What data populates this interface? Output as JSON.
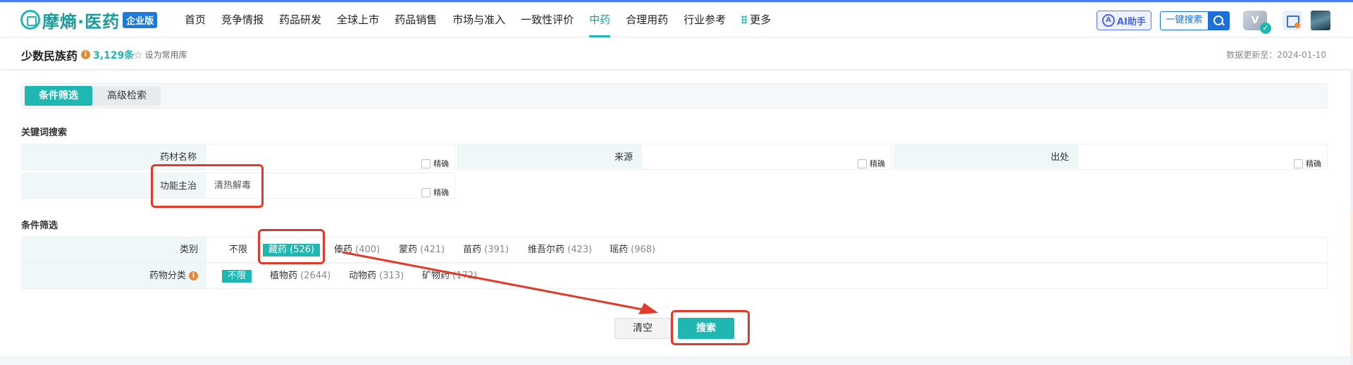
{
  "app": {
    "logo_text": "摩熵·医药",
    "edition_badge": "企业版"
  },
  "nav": {
    "items": [
      {
        "label": "首页"
      },
      {
        "label": "竞争情报"
      },
      {
        "label": "药品研发"
      },
      {
        "label": "全球上市"
      },
      {
        "label": "药品销售"
      },
      {
        "label": "市场与准入"
      },
      {
        "label": "一致性评价"
      },
      {
        "label": "中药",
        "active": true
      },
      {
        "label": "合理用药"
      },
      {
        "label": "行业参考"
      },
      {
        "label": "更多"
      }
    ],
    "ai_label": "AI助手",
    "search_label": "一键搜索",
    "vip_label": "V"
  },
  "subheader": {
    "title": "少数民族药",
    "count": "3,129条",
    "favorite_label": "设为常用库",
    "update_text": "数据更新至：2024-01-10"
  },
  "tabs": {
    "active": "条件筛选",
    "advanced": "高级检索"
  },
  "keyword": {
    "section_title": "关键词搜索",
    "exact_label": "精确",
    "fields": [
      {
        "label": "药材名称",
        "value": ""
      },
      {
        "label": "来源",
        "value": ""
      },
      {
        "label": "出处",
        "value": ""
      },
      {
        "label": "功能主治",
        "value": "清热解毒"
      }
    ]
  },
  "filter": {
    "section_title": "条件筛选",
    "category": {
      "label": "类别",
      "options": [
        {
          "name": "不限",
          "count": ""
        },
        {
          "name": "藏药",
          "count": "(526)",
          "selected": true
        },
        {
          "name": "傣药",
          "count": "(400)"
        },
        {
          "name": "蒙药",
          "count": "(421)"
        },
        {
          "name": "苗药",
          "count": "(391)"
        },
        {
          "name": "维吾尔药",
          "count": "(423)"
        },
        {
          "name": "瑶药",
          "count": "(968)"
        }
      ]
    },
    "drug_class": {
      "label": "药物分类",
      "options": [
        {
          "name": "不限",
          "count": "",
          "selected": true
        },
        {
          "name": "植物药",
          "count": "(2644)"
        },
        {
          "name": "动物药",
          "count": "(313)"
        },
        {
          "name": "矿物药",
          "count": "(172)"
        }
      ]
    }
  },
  "actions": {
    "clear": "清空",
    "search": "搜索"
  },
  "colors": {
    "accent": "#20b7b2",
    "brand_blue": "#1e6fd6",
    "annotation_red": "#e03b2a"
  }
}
